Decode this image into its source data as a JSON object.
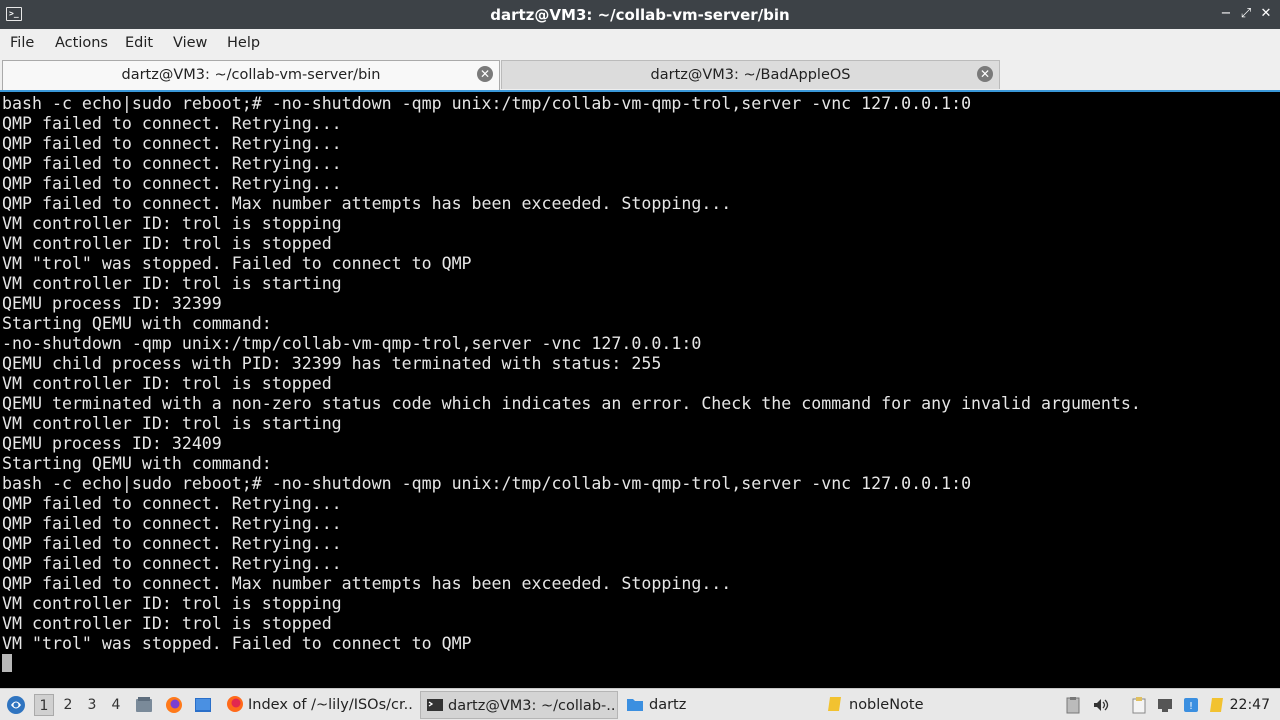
{
  "window": {
    "title": "dartz@VM3: ~/collab-vm-server/bin",
    "controls": {
      "minimize": "−",
      "restore": "⤢",
      "close": "✕"
    }
  },
  "menu": [
    "File",
    "Actions",
    "Edit",
    "View",
    "Help"
  ],
  "tabs": [
    {
      "label": "dartz@VM3: ~/collab-vm-server/bin",
      "active": true
    },
    {
      "label": "dartz@VM3: ~/BadAppleOS",
      "active": false
    }
  ],
  "terminal": {
    "lines": [
      "bash -c echo|sudo reboot;# -no-shutdown -qmp unix:/tmp/collab-vm-qmp-trol,server -vnc 127.0.0.1:0",
      "QMP failed to connect. Retrying...",
      "QMP failed to connect. Retrying...",
      "QMP failed to connect. Retrying...",
      "QMP failed to connect. Retrying...",
      "QMP failed to connect. Max number attempts has been exceeded. Stopping...",
      "VM controller ID: trol is stopping",
      "VM controller ID: trol is stopped",
      "VM \"trol\" was stopped. Failed to connect to QMP",
      "VM controller ID: trol is starting",
      "QEMU process ID: 32399",
      "Starting QEMU with command:",
      "-no-shutdown -qmp unix:/tmp/collab-vm-qmp-trol,server -vnc 127.0.0.1:0",
      "QEMU child process with PID: 32399 has terminated with status: 255",
      "VM controller ID: trol is stopped",
      "QEMU terminated with a non-zero status code which indicates an error. Check the command for any invalid arguments.",
      "VM controller ID: trol is starting",
      "QEMU process ID: 32409",
      "Starting QEMU with command:",
      "bash -c echo|sudo reboot;# -no-shutdown -qmp unix:/tmp/collab-vm-qmp-trol,server -vnc 127.0.0.1:0",
      "QMP failed to connect. Retrying...",
      "QMP failed to connect. Retrying...",
      "QMP failed to connect. Retrying...",
      "QMP failed to connect. Retrying...",
      "QMP failed to connect. Max number attempts has been exceeded. Stopping...",
      "VM controller ID: trol is stopping",
      "VM controller ID: trol is stopped",
      "VM \"trol\" was stopped. Failed to connect to QMP"
    ]
  },
  "taskbar": {
    "workspaces": [
      "1",
      "2",
      "3",
      "4"
    ],
    "current_workspace": "1",
    "tasks": [
      {
        "label": "Index of /~lily/ISOs/cr...",
        "icon": "firefox-icon"
      },
      {
        "label": "dartz@VM3: ~/collab-...",
        "icon": "terminal-icon",
        "active": true
      },
      {
        "label": "dartz",
        "icon": "folder-icon"
      },
      {
        "label": "nobleNote",
        "icon": "note-icon"
      }
    ],
    "clock": "22:47"
  },
  "colors": {
    "titlebar": "#3d4247",
    "accent": "#3a98d9",
    "terminal_bg": "#000000",
    "terminal_fg": "#e6e6e6"
  }
}
